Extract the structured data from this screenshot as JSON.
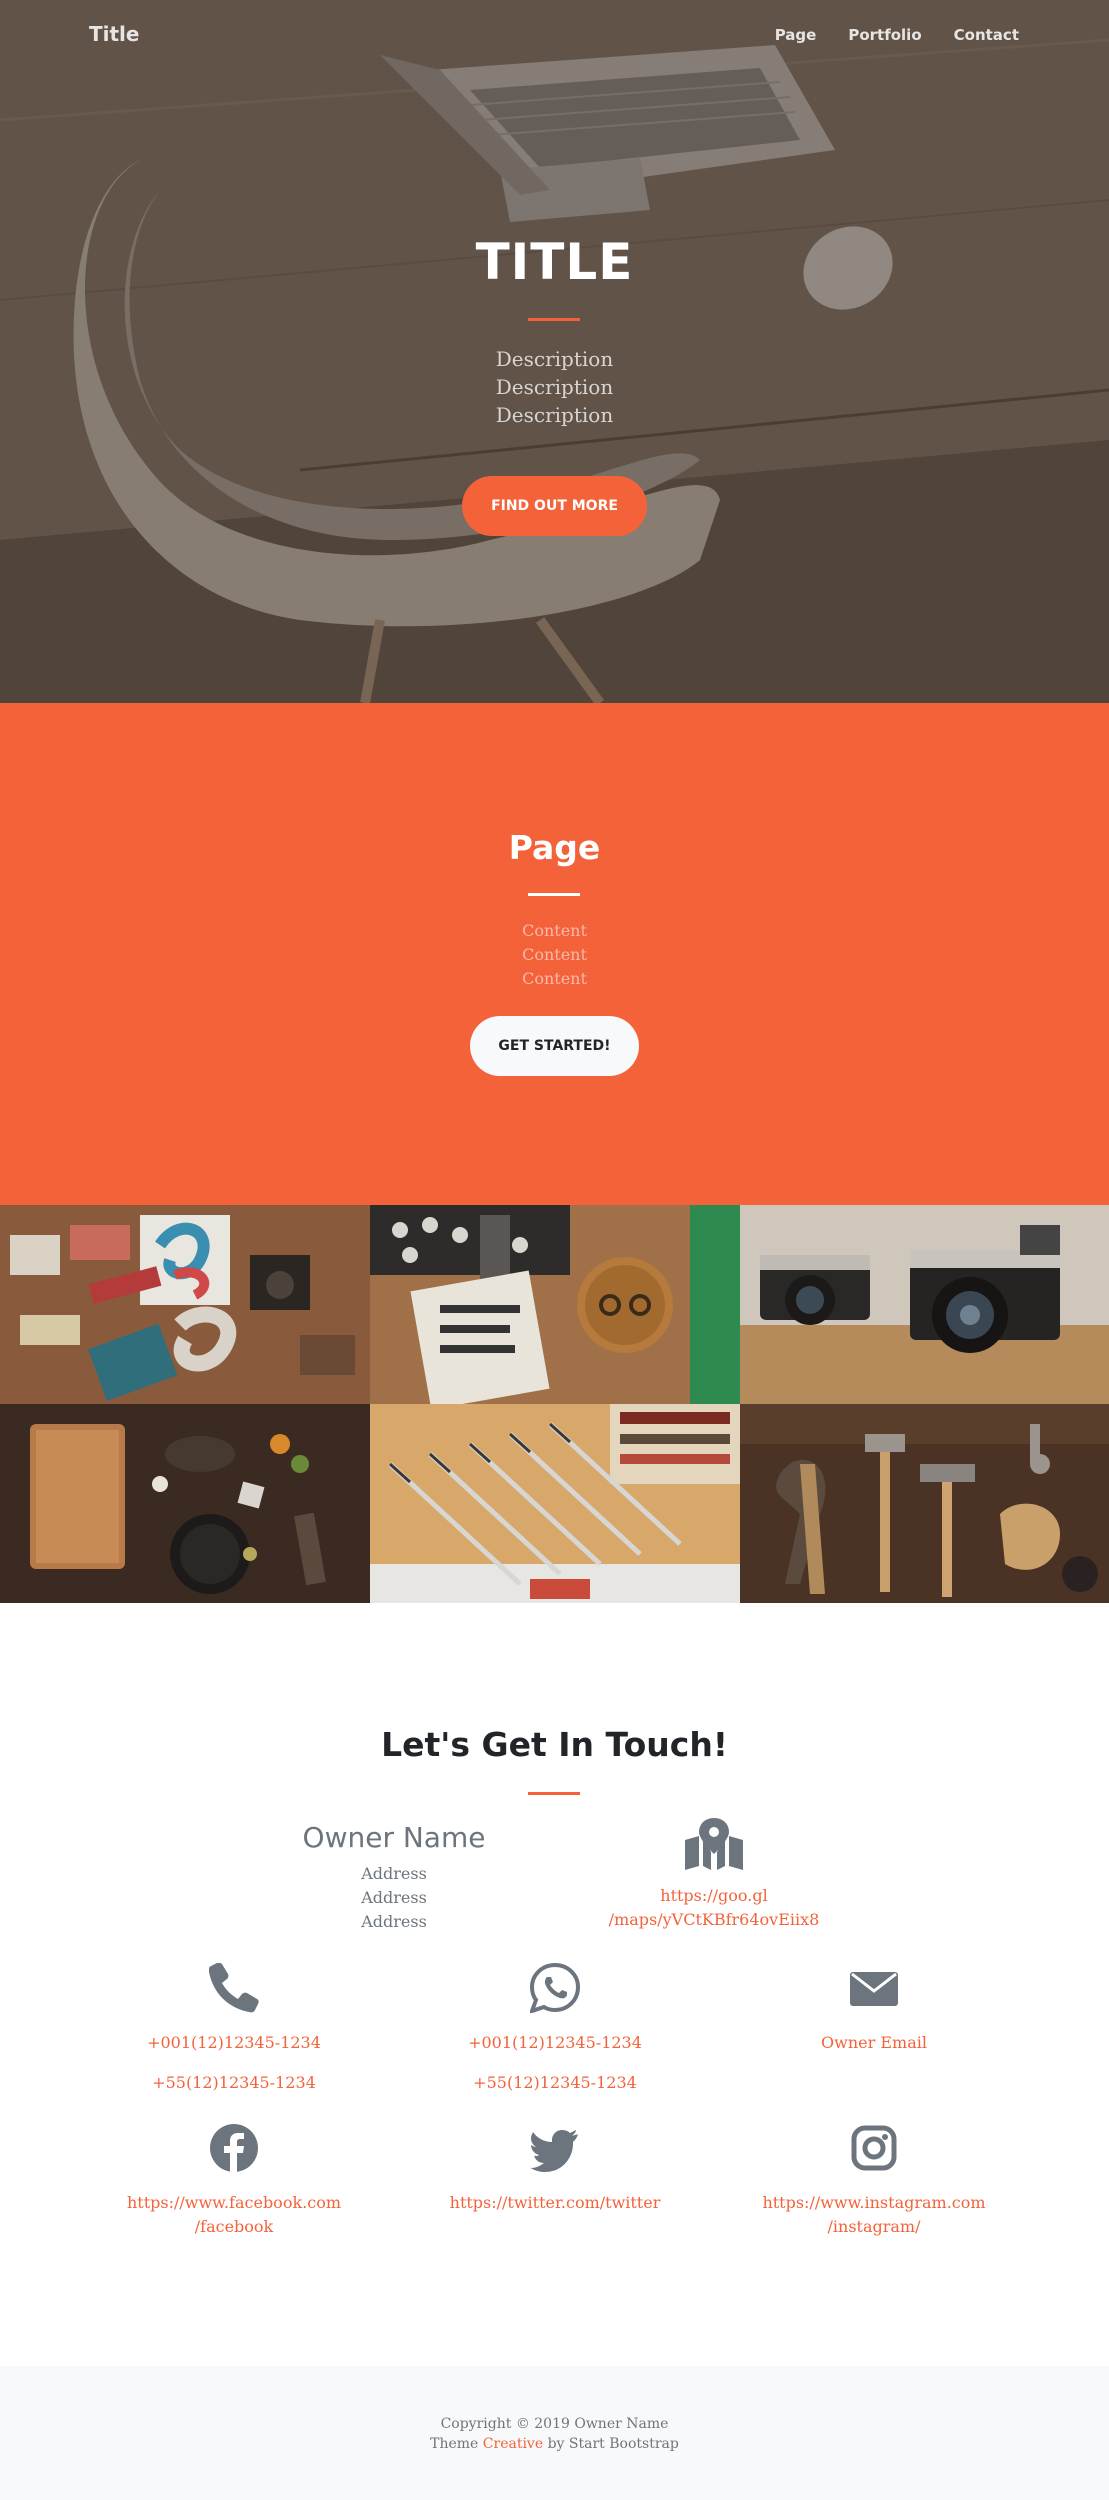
{
  "nav": {
    "brand": "Title",
    "links": [
      "Page",
      "Portfolio",
      "Contact"
    ]
  },
  "hero": {
    "title": "TITLE",
    "description": [
      "Description",
      "Description",
      "Description"
    ],
    "button": "FIND OUT MORE"
  },
  "page": {
    "title": "Page",
    "content": [
      "Content",
      "Content",
      "Content"
    ],
    "button": "GET STARTED!"
  },
  "portfolio": {
    "tiles": [
      "stationery-flatlay",
      "coasters-desk",
      "vintage-cameras",
      "kitchen-tools",
      "pens-drafting",
      "hand-tools"
    ]
  },
  "contact": {
    "title": "Let's Get In Touch!",
    "owner_name": "Owner Name",
    "address": [
      "Address",
      "Address",
      "Address"
    ],
    "map_link": [
      "https://goo.gl",
      "/maps/yVCtKBfr64ovEiix8"
    ],
    "phone": [
      "+001(12)12345-1234",
      "+55(12)12345-1234"
    ],
    "whatsapp": [
      "+001(12)12345-1234",
      "+55(12)12345-1234"
    ],
    "email": "Owner Email",
    "facebook": [
      "https://www.facebook.com",
      "/facebook"
    ],
    "twitter": "https://twitter.com/twitter",
    "instagram": [
      "https://www.instagram.com",
      "/instagram/"
    ]
  },
  "footer": {
    "copyright": "Copyright © 2019 Owner Name",
    "theme_prefix": "Theme",
    "theme_name": "Creative",
    "theme_suffix": "by Start Bootstrap"
  },
  "colors": {
    "accent": "#f4623a",
    "footer_bg": "#f8f9fa",
    "icon_gray": "#6c757d"
  }
}
